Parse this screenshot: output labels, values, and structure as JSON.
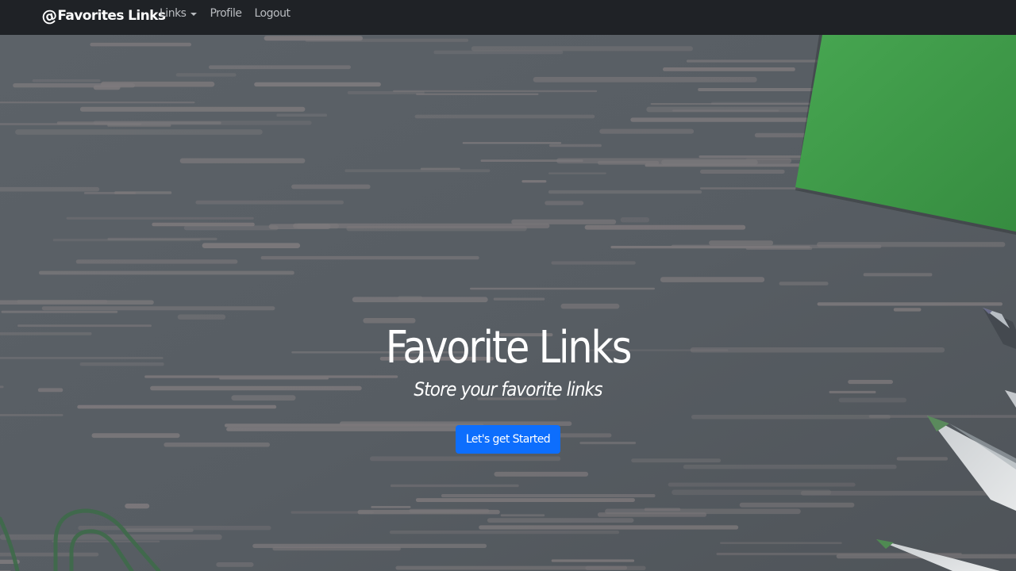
{
  "navbar": {
    "brand_label": "Favorites Links",
    "brand_icon": "at-sign-icon",
    "links": [
      {
        "label": "Links",
        "has_dropdown": true
      },
      {
        "label": "Profile"
      },
      {
        "label": "Logout"
      }
    ]
  },
  "hero": {
    "title": "Favorite Links",
    "subtitle": "Store your favorite links",
    "cta_label": "Let's get Started"
  },
  "colors": {
    "navbar_bg": "#1f2226",
    "accent": "#0d6efd",
    "hero_bg": "#5b6166",
    "notepad": "#3e9a48"
  }
}
